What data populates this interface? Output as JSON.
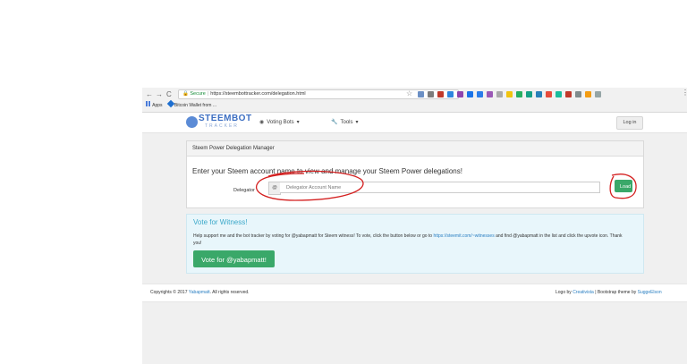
{
  "browser": {
    "back": "←",
    "forward": "→",
    "reload": "C",
    "secure_label": "Secure",
    "url": "https://steembottracker.com/delegation.html",
    "menu": "⋮",
    "bookmarks": [
      {
        "label": "Apps",
        "icon": "apps-grid-icon"
      },
      {
        "label": "Bitcoin Wallet from ...",
        "icon": "wallet-icon"
      }
    ],
    "extension_colors": [
      "#6b8fc4",
      "#7c7c7c",
      "#c0392b",
      "#2e86de",
      "#8e44ad",
      "#1a73e8",
      "#2b7de9",
      "#9b59b6",
      "#aaaaaa",
      "#f1c40f",
      "#27ae60",
      "#16a085",
      "#2980b9",
      "#e74c3c",
      "#1abc9c",
      "#c0392b",
      "#7f8c8d",
      "#f39c12",
      "#95a5a6"
    ]
  },
  "navbar": {
    "logo_title": "STEEMBOT",
    "logo_subtitle": "TRACKER",
    "voting_bots": "Voting Bots",
    "tools": "Tools",
    "login": "Log in"
  },
  "panel": {
    "heading": "Steem Power Delegation Manager",
    "instruction": "Enter your Steem account name to view and manage your Steem Power delegations!",
    "delegator_label": "Delegator",
    "addon": "@",
    "input_placeholder": "Delegator Account Name",
    "load_button": "Load"
  },
  "witness": {
    "title": "Vote for Witness!",
    "body_1": "Help support me and the bot tracker by voting for @yabapmatt for Steem witness! To vote, click the button below or go to ",
    "body_link": "https://steemit.com/~witnesses",
    "body_2": " and find @yabapmatt in the list and click the upvote icon. Thank you!",
    "button": "Vote for @yabapmatt!"
  },
  "footer": {
    "copyright_prefix": "Copyrights © 2017 ",
    "copyright_name": "Yabapmatt",
    "copyright_suffix": ". All rights reserved.",
    "logo_by": "Logo by ",
    "logo_author": "Creativista",
    "theme_by": " | Bootstrap theme by ",
    "theme_author": "SuggeElson"
  }
}
